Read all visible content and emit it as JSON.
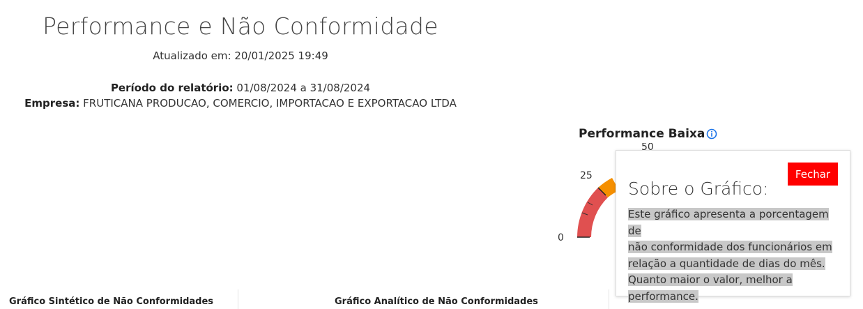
{
  "header": {
    "title": "Performance e Não Conformidade",
    "updated": "Atualizado em: 20/01/2025 19:49",
    "period_label": "Período do relatório:",
    "period_value": " 01/08/2024 a 31/08/2024",
    "company_label": "Empresa:",
    "company_value": " FRUTICANA PRODUCAO, COMERCIO, IMPORTACAO E EXPORTACAO LTDA"
  },
  "gauge": {
    "title": "Performance Baixa",
    "info_icon": "info-icon",
    "tick_labels": [
      "0",
      "25",
      "50"
    ],
    "colors": {
      "low": "#e05050",
      "mid": "#f58f00"
    }
  },
  "popover": {
    "close_label": "Fechar",
    "title": "Sobre o Gráfico:",
    "lines": [
      "Este gráfico apresenta a porcentagem de",
      "não conformidade dos funcionários em",
      "relação a quantidade de dias do mês.",
      "Quanto maior o valor, melhor a",
      "performance."
    ]
  },
  "footer": {
    "left_title": "Gráfico Sintético de Não Conformidades",
    "mid_title": "Gráfico Analítico de Não Conformidades"
  }
}
